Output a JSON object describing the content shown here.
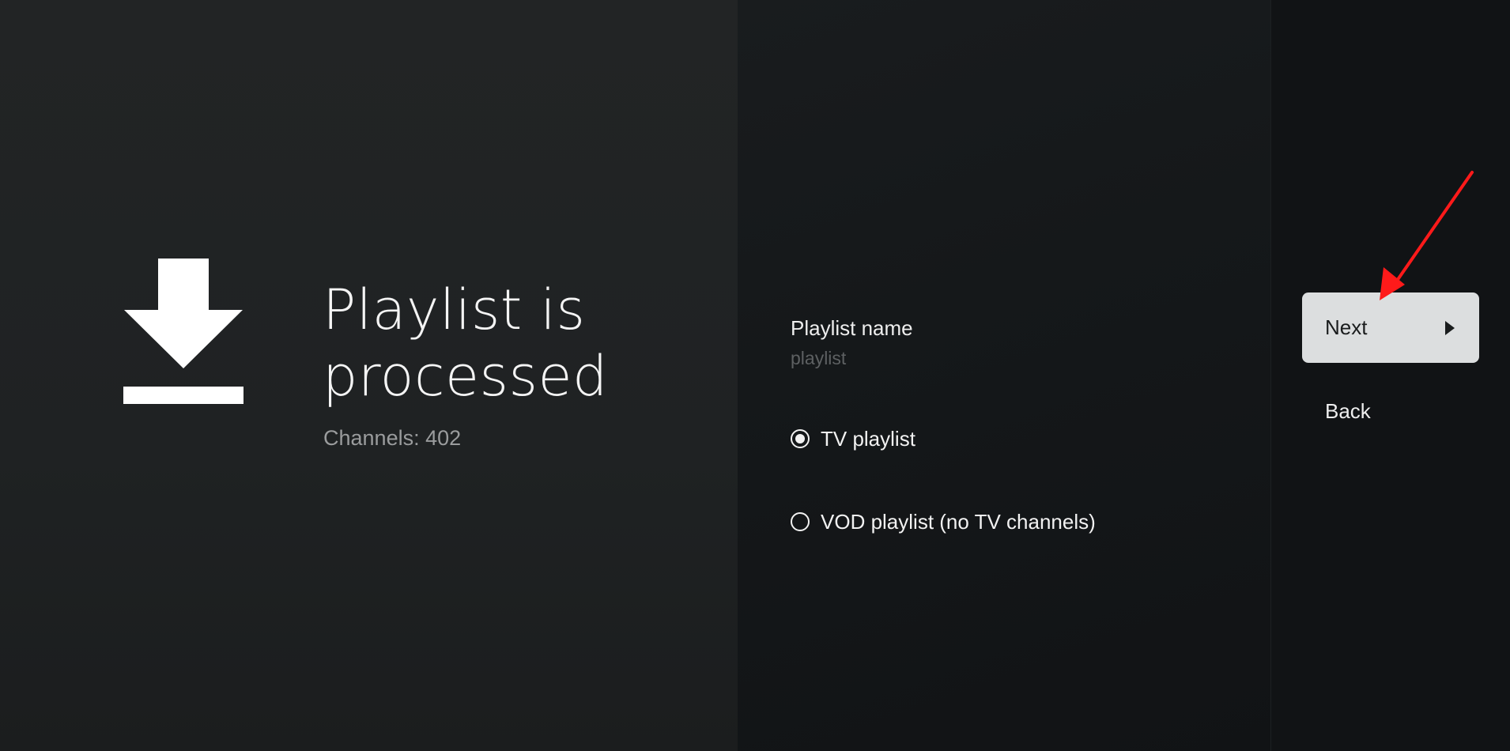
{
  "info_panel": {
    "headline": "Playlist is processed",
    "channels_text": "Channels: 402",
    "icon": "download-icon"
  },
  "form": {
    "name_label": "Playlist name",
    "name_value": "playlist",
    "options": [
      {
        "label": "TV playlist",
        "selected": true
      },
      {
        "label": "VOD playlist (no TV channels)",
        "selected": false
      }
    ]
  },
  "actions": {
    "next_label": "Next",
    "back_label": "Back",
    "next_icon": "play-arrow-icon"
  },
  "annotation": {
    "arrow_color": "#ff1a1a",
    "target": "next-button"
  },
  "colors": {
    "panel_left": "#222425",
    "panel_mid": "#15181a",
    "panel_right": "#111315",
    "focused_button": "#dcdedf"
  }
}
